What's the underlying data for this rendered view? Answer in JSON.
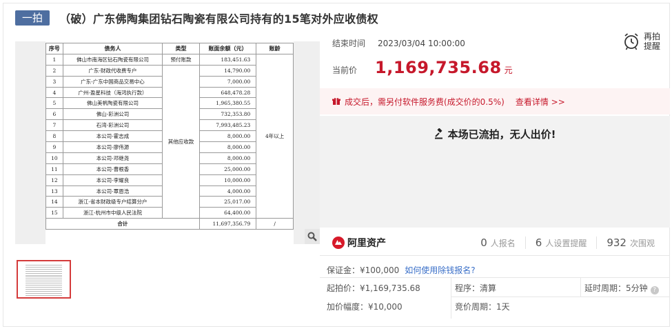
{
  "header": {
    "tag": "一拍",
    "title": "（破）广东佛陶集团钻石陶瓷有限公司持有的15笔对外应收债权"
  },
  "debt_table": {
    "headers": [
      "序号",
      "债务人",
      "类型",
      "账面余额（元）",
      "账龄"
    ],
    "type_prepay": "预付账款",
    "type_other": "其他应收款",
    "age": "4年以上",
    "rows": [
      {
        "no": "1",
        "debtor": "佛山市南海区钻石陶瓷有限公司",
        "amount": "183,451.63"
      },
      {
        "no": "2",
        "debtor": "广东-财政代收费专户",
        "amount": "14,790.00"
      },
      {
        "no": "3",
        "debtor": "广东-广东中国商品交易中心",
        "amount": "7,000.00"
      },
      {
        "no": "4",
        "debtor": "广州-盈星科技（海鸿执行款）",
        "amount": "648,478.28"
      },
      {
        "no": "5",
        "debtor": "佛山美帆陶瓷有限公司",
        "amount": "1,965,380.55"
      },
      {
        "no": "6",
        "debtor": "佛山-彩洲公司",
        "amount": "732,353.80"
      },
      {
        "no": "7",
        "debtor": "石湾-彩洲公司",
        "amount": "7,993,485.23"
      },
      {
        "no": "8",
        "debtor": "本公司-霍志成",
        "amount": "8,000.00"
      },
      {
        "no": "9",
        "debtor": "本公司-廖伟源",
        "amount": "8,000.00"
      },
      {
        "no": "10",
        "debtor": "本公司-邓继尧",
        "amount": "8,000.00"
      },
      {
        "no": "11",
        "debtor": "本公司-曹根香",
        "amount": "25,000.00"
      },
      {
        "no": "12",
        "debtor": "本公司-李耀良",
        "amount": "10,000.00"
      },
      {
        "no": "13",
        "debtor": "本公司-覃恩浩",
        "amount": "4,000.00"
      },
      {
        "no": "14",
        "debtor": "浙江-省本财政级专户结算分户",
        "amount": "25,017.00"
      },
      {
        "no": "15",
        "debtor": "浙江-杭州市中级人民法院",
        "amount": "64,400.00"
      }
    ],
    "total_label": "合计",
    "total_amount": "11,697,356.79",
    "total_age": "/"
  },
  "auction": {
    "end_label": "结束时间",
    "end_time": "2023/03/04 10:00:00",
    "remind_label": "再拍提醒",
    "price_label": "当前价",
    "price_value": "1,169,735.68",
    "price_unit": "元",
    "fee_text": "成交后，需另付软件服务费(成交价的0.5%)",
    "fee_link": "查看详情 >>",
    "status": "本场已流拍，无人出价!"
  },
  "stats": {
    "logo_text": "阿里资产",
    "signup_num": "0",
    "signup_label": "人报名",
    "remind_num": "6",
    "remind_label": "人设置提醒",
    "view_num": "932",
    "view_label": "次围观"
  },
  "details": {
    "deposit": "保证金：¥100,000",
    "deposit_link": "如何使用除钱报名?",
    "start_price": "起拍价：¥1,169,735.68",
    "procedure": "程序：清算",
    "delay": "延时周期：5分钟",
    "increment": "加价幅度：¥10,000",
    "bid_period": "竞价周期：1天"
  },
  "colors": {
    "accent_red": "#c6182b",
    "tag_blue": "#4e6ea0",
    "link_blue": "#3a6fc8"
  }
}
